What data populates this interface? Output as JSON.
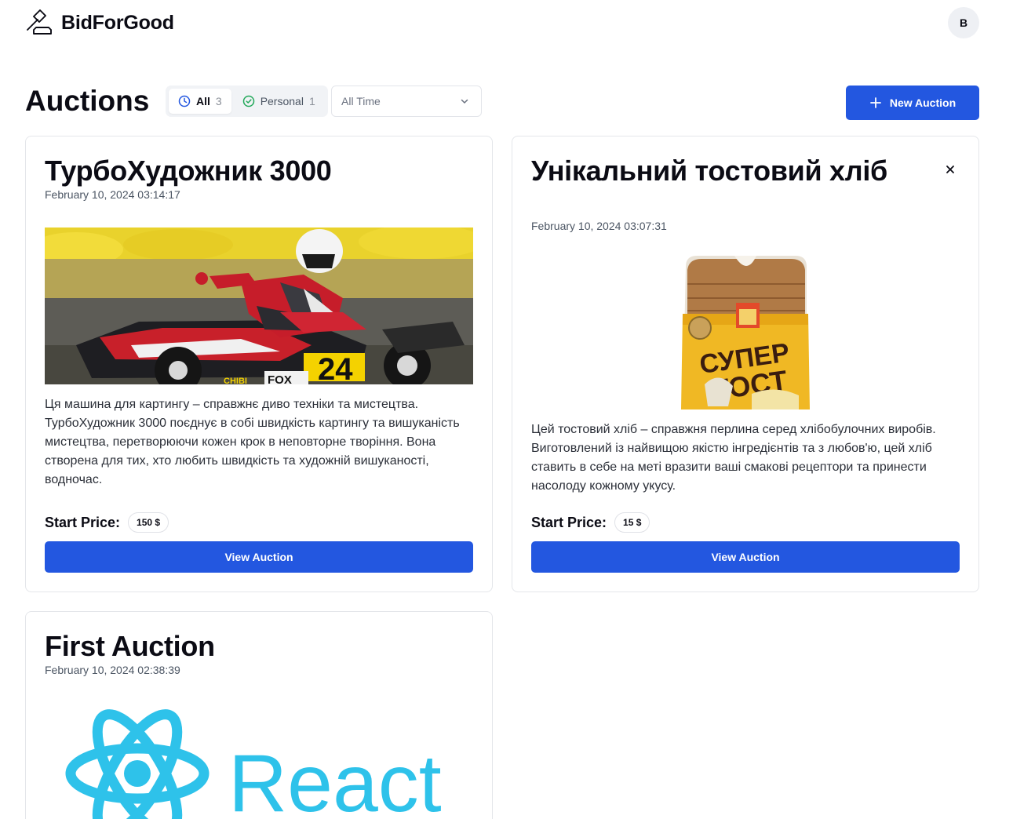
{
  "app": {
    "name": "BidForGood",
    "logo_icon": "gavel-icon"
  },
  "user": {
    "avatar_initial": "B"
  },
  "page": {
    "title": "Auctions"
  },
  "filters": {
    "tabs": [
      {
        "label": "All",
        "count": "3",
        "icon": "clock-icon",
        "active": true
      },
      {
        "label": "Personal",
        "count": "1",
        "icon": "check-circle-icon",
        "active": false
      }
    ],
    "period": {
      "selected": "All Time",
      "icon": "chevron-down-icon"
    }
  },
  "actions": {
    "new_auction_label": "New Auction",
    "new_auction_icon": "plus-icon"
  },
  "colors": {
    "primary": "#2357e0",
    "text": "#0b0b14",
    "muted": "#4b5563",
    "border": "#e4e6ea",
    "check_green": "#22a85a"
  },
  "auctions": [
    {
      "title": "ТурбоХудожник 3000",
      "date": "February 10, 2024 03:14:17",
      "image": "go-kart-racer-photo",
      "image_text": [
        "24",
        "FOX",
        "CHIBI"
      ],
      "description": "Ця машина для картингу – справжнє диво техніки та мистецтва. ТурбоХудожник 3000 поєднує в собі швидкість картингу та вишуканість мистецтва, перетворюючи кожен крок в неповторне творіння. Вона створена для тих, хто любить швидкість та художній вишуканості, водночас.",
      "price_label": "Start Price:",
      "price": "150 $",
      "button_label": "View Auction",
      "closable": false
    },
    {
      "title": "Унікальний тостовий хліб",
      "date": "February 10, 2024 03:07:31",
      "image": "toast-bread-package-photo",
      "image_text": [
        "СУПЕР",
        "ТОСТ"
      ],
      "description": "Цей тостовий хліб – справжня перлина серед хлібобулочних виробів. Виготовлений із найвищою якістю інгредієнтів та з любов'ю, цей хліб ставить в себе на меті вразити ваші смакові рецептори та принести насолоду кожному укусу.",
      "price_label": "Start Price:",
      "price": "15 $",
      "button_label": "View Auction",
      "closable": true
    },
    {
      "title": "First Auction",
      "date": "February 10, 2024 02:38:39",
      "image": "react-logo-image",
      "image_text": [
        "React"
      ],
      "closable": false
    }
  ]
}
